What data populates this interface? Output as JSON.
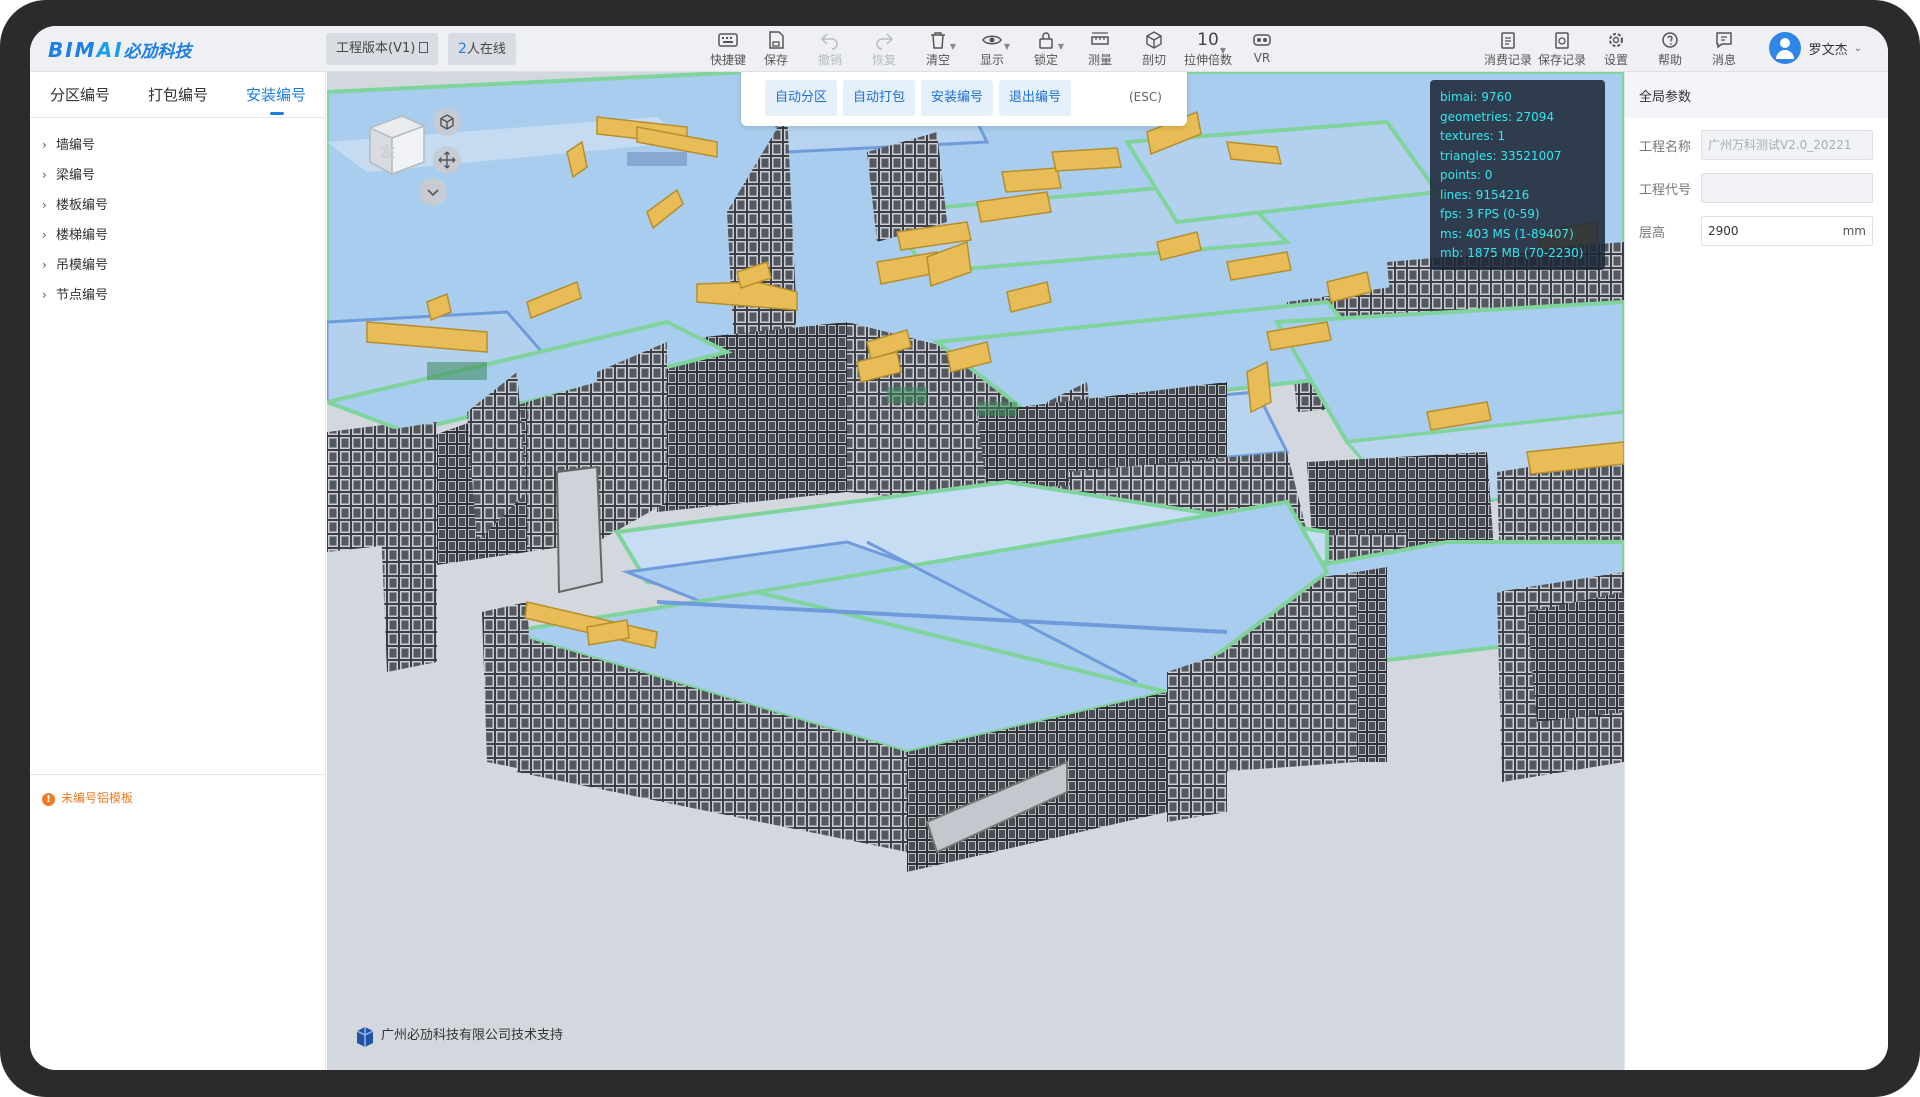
{
  "app": {
    "logo_main": "BIM",
    "logo_ai": "AI",
    "logo_cn": "必劢科技",
    "version_label": "工程版本(V1)",
    "online_count": "2",
    "online_label": "人在线"
  },
  "toolbar": {
    "items": [
      {
        "label": "快捷键",
        "icon": "keyboard-icon"
      },
      {
        "label": "保存",
        "icon": "save-icon"
      },
      {
        "label": "撤销",
        "icon": "undo-icon"
      },
      {
        "label": "恢复",
        "icon": "redo-icon"
      },
      {
        "label": "清空",
        "icon": "trash-icon"
      },
      {
        "label": "显示",
        "icon": "eye-icon"
      },
      {
        "label": "锁定",
        "icon": "lock-icon"
      },
      {
        "label": "测量",
        "icon": "ruler-icon"
      },
      {
        "label": "剖切",
        "icon": "section-cube-icon"
      },
      {
        "label": "拉伸倍数",
        "value": "10"
      },
      {
        "label": "VR",
        "icon": "vr-icon"
      }
    ],
    "right_items": [
      {
        "label": "消费记录",
        "icon": "bill-icon"
      },
      {
        "label": "保存记录",
        "icon": "save-history-icon"
      },
      {
        "label": "设置",
        "icon": "gear-icon"
      },
      {
        "label": "帮助",
        "icon": "help-icon"
      },
      {
        "label": "消息",
        "icon": "message-icon"
      }
    ],
    "user_name": "罗文杰"
  },
  "left_panel": {
    "tabs": [
      "分区编号",
      "打包编号",
      "安装编号"
    ],
    "active_tab": "安装编号",
    "tree": [
      "墙编号",
      "梁编号",
      "楼板编号",
      "楼梯编号",
      "吊模编号",
      "节点编号"
    ],
    "warning": "未编号铝模板"
  },
  "viewport": {
    "action_buttons": [
      "自动分区",
      "自动打包",
      "安装编号",
      "退出编号"
    ],
    "esc_hint": "(ESC)",
    "stats": [
      {
        "key": "bimai:",
        "value": "9760"
      },
      {
        "key": "geometries:",
        "value": "27094"
      },
      {
        "key": "textures:",
        "value": "1"
      },
      {
        "key": "triangles:",
        "value": "33521007"
      },
      {
        "key": "points:",
        "value": "0"
      },
      {
        "key": "lines:",
        "value": "9154216"
      },
      {
        "key": "fps:",
        "value": "3 FPS (0-59)"
      },
      {
        "key": "ms:",
        "value": "403 MS (1-89407)"
      },
      {
        "key": "mb:",
        "value": "1875 MB (70-2230)"
      }
    ],
    "cube_face": "左",
    "footer": "广州必劢科技有限公司技术支持"
  },
  "right_panel": {
    "title": "全局参数",
    "project_name_label": "工程名称",
    "project_name_value": "广州万科测试V2.0_20221",
    "project_code_label": "工程代号",
    "project_code_value": "",
    "floor_height_label": "层高",
    "floor_height_value": "2900",
    "floor_height_unit": "mm"
  },
  "colors": {
    "accent": "#1d7fe6",
    "slab": "#9ec4ea",
    "beam": "#e8bc56",
    "edge_green": "#7ecf92",
    "wall": "#3a3d43",
    "stats_text": "#34e6f0",
    "warning": "#f07b22"
  }
}
